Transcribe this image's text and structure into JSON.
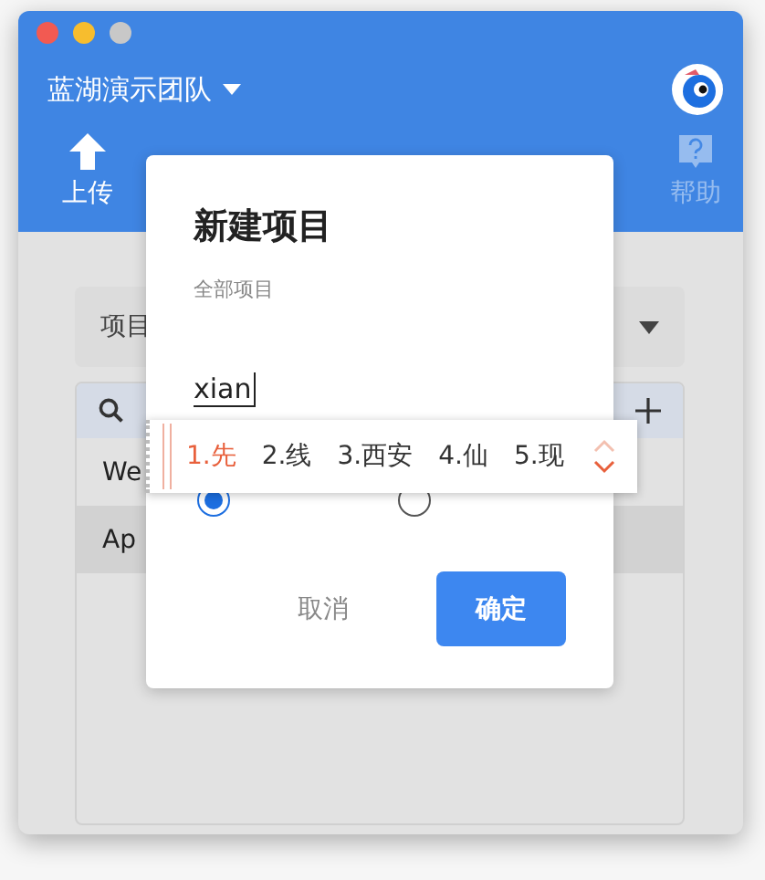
{
  "window": {
    "team": "蓝湖演示团队"
  },
  "toolbar": [
    {
      "kind": "upload",
      "label": "上传",
      "disabled": false
    },
    {
      "kind": "help",
      "label": "帮助",
      "disabled": true
    }
  ],
  "background": {
    "dropdown": "项目",
    "rows": [
      {
        "label": "We",
        "selected": false
      },
      {
        "label": "Ap",
        "selected": true
      }
    ]
  },
  "dialog": {
    "title": "新建项目",
    "subtitle": "全部项目",
    "input_value": "xian",
    "radios": [
      {
        "selected": true
      },
      {
        "selected": false
      }
    ],
    "cancel": "取消",
    "confirm": "确定"
  },
  "ime": {
    "candidates": [
      {
        "label": "1.先",
        "selected": true
      },
      {
        "label": "2.线",
        "selected": false
      },
      {
        "label": "3.西安",
        "selected": false
      },
      {
        "label": "4.仙",
        "selected": false
      },
      {
        "label": "5.现",
        "selected": false
      }
    ]
  }
}
